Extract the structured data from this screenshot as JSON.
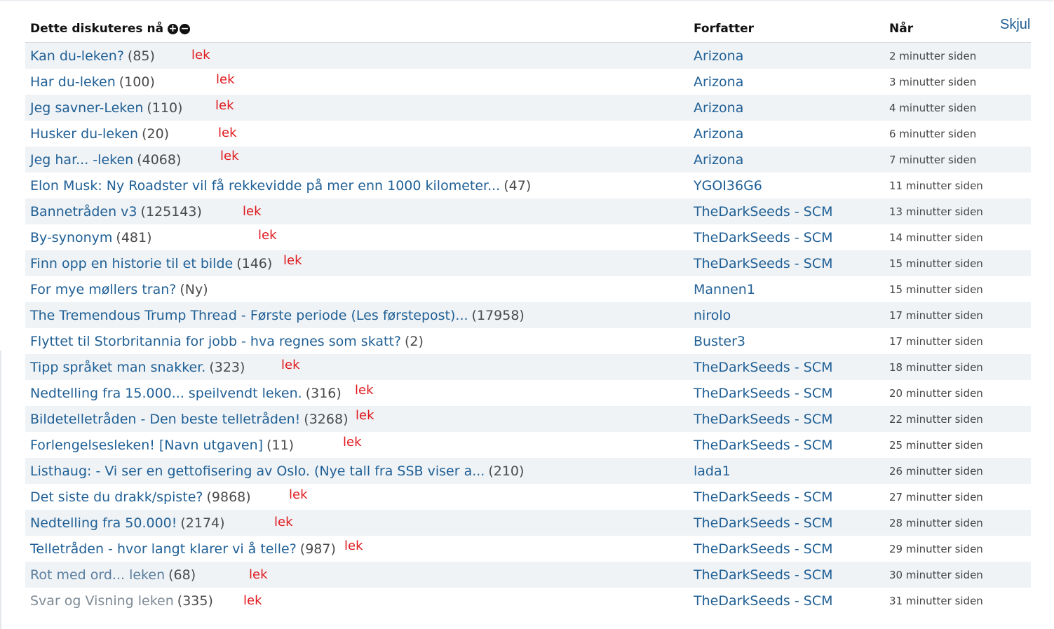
{
  "hide_label": "Skjul",
  "header": {
    "topic": "Dette diskuteres nå",
    "expand_icon": "+",
    "collapse_icon": "−",
    "author": "Forfatter",
    "when": "Når"
  },
  "rows": [
    {
      "title": "Kan du-leken?",
      "count": "(85)",
      "tag": "lek",
      "author": "Arizona",
      "time": "2 minutter siden"
    },
    {
      "title": "Har du-leken",
      "count": "(100)",
      "tag": "lek",
      "author": "Arizona",
      "time": "3 minutter siden"
    },
    {
      "title": "Jeg savner-Leken",
      "count": "(110)",
      "tag": "lek",
      "author": "Arizona",
      "time": "4 minutter siden"
    },
    {
      "title": "Husker du-leken",
      "count": "(20)",
      "tag": "lek",
      "author": "Arizona",
      "time": "6 minutter siden"
    },
    {
      "title": "Jeg har... -leken",
      "count": "(4068)",
      "tag": "lek",
      "author": "Arizona",
      "time": "7 minutter siden"
    },
    {
      "title": "Elon Musk: Ny Roadster vil få rekkevidde på mer enn 1000 kilometer...",
      "count": "(47)",
      "tag": "",
      "author": "YGOI36G6",
      "time": "11 minutter siden"
    },
    {
      "title": "Bannetråden v3",
      "count": "(125143)",
      "tag": "lek",
      "author": "TheDarkSeeds - SCM",
      "time": "13 minutter siden"
    },
    {
      "title": "By-synonym",
      "count": "(481)",
      "tag": "lek",
      "author": "TheDarkSeeds - SCM",
      "time": "14 minutter siden"
    },
    {
      "title": "Finn opp en historie til et bilde",
      "count": "(146)",
      "tag": "lek",
      "author": "TheDarkSeeds - SCM",
      "time": "15 minutter siden"
    },
    {
      "title": "For mye møllers tran?",
      "count": "(Ny)",
      "tag": "",
      "author": "Mannen1",
      "time": "15 minutter siden"
    },
    {
      "title": "The Tremendous Trump Thread - Første periode (Les førstepost)...",
      "count": "(17958)",
      "tag": "",
      "author": "nirolo",
      "time": "17 minutter siden"
    },
    {
      "title": "Flyttet til Storbritannia for jobb - hva regnes som skatt?",
      "count": "(2)",
      "tag": "",
      "author": "Buster3",
      "time": "17 minutter siden"
    },
    {
      "title": "Tipp språket man snakker.",
      "count": "(323)",
      "tag": "lek",
      "author": "TheDarkSeeds - SCM",
      "time": "18 minutter siden"
    },
    {
      "title": "Nedtelling fra 15.000... speilvendt leken.",
      "count": "(316)",
      "tag": "lek",
      "author": "TheDarkSeeds - SCM",
      "time": "20 minutter siden"
    },
    {
      "title": "Bildetelletråden - Den beste telletråden!",
      "count": "(3268)",
      "tag": "lek",
      "author": "TheDarkSeeds - SCM",
      "time": "22 minutter siden"
    },
    {
      "title": "Forlengelsesleken! [Navn utgaven]",
      "count": "(11)",
      "tag": "lek",
      "author": "TheDarkSeeds - SCM",
      "time": "25 minutter siden"
    },
    {
      "title": "Listhaug: - Vi ser en gettofisering av Oslo. (Nye tall fra SSB viser a...",
      "count": "(210)",
      "tag": "",
      "author": "lada1",
      "time": "26 minutter siden"
    },
    {
      "title": "Det siste du drakk/spiste?",
      "count": "(9868)",
      "tag": "lek",
      "author": "TheDarkSeeds - SCM",
      "time": "27 minutter siden"
    },
    {
      "title": "Nedtelling fra 50.000!",
      "count": "(2174)",
      "tag": "lek",
      "author": "TheDarkSeeds - SCM",
      "time": "28 minutter siden"
    },
    {
      "title": "Telletråden - hvor langt klarer vi å telle?",
      "count": "(987)",
      "tag": "lek",
      "author": "TheDarkSeeds - SCM",
      "time": "29 minutter siden"
    },
    {
      "title": "Rot med ord... leken",
      "count": "(68)",
      "tag": "lek",
      "author": "TheDarkSeeds - SCM",
      "time": "30 minutter siden"
    },
    {
      "title": "Svar og Visning leken",
      "count": "(335)",
      "tag": "lek",
      "author": "TheDarkSeeds - SCM",
      "time": "31 minutter siden"
    }
  ]
}
